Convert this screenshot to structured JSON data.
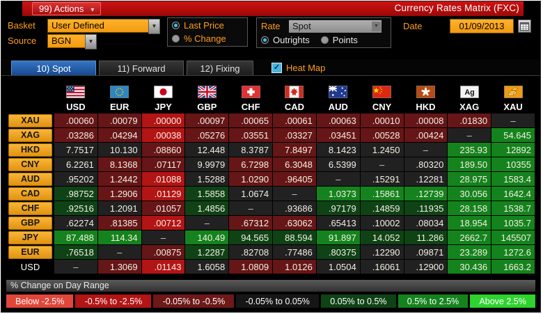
{
  "titlebar": {
    "actions_label": "99) Actions",
    "title": "Currency Rates Matrix (FXC)"
  },
  "icons": {
    "dropdown": "▼",
    "caret": "▾"
  },
  "controls": {
    "basket_label": "Basket",
    "basket_value": "User Defined",
    "source_label": "Source",
    "source_value": "BGN",
    "price_options": [
      {
        "label": "Last Price",
        "selected": true
      },
      {
        "label": "% Change",
        "selected": false
      }
    ],
    "rate_label": "Rate",
    "rate_value": "Spot",
    "rate_options": [
      {
        "label": "Outrights",
        "selected": true
      },
      {
        "label": "Points",
        "selected": false
      }
    ],
    "date_label": "Date",
    "date_value": "01/09/2013"
  },
  "tabs": [
    {
      "label": "10) Spot",
      "selected": true
    },
    {
      "label": "11) Forward",
      "selected": false
    },
    {
      "label": "12) Fixing",
      "selected": false
    }
  ],
  "heatmap": {
    "label": "Heat Map",
    "checked": true,
    "check_glyph": "✓"
  },
  "palette": {
    "r3": "#e2463a",
    "r2": "#b31414",
    "r1": "#661616",
    "n": "#212121",
    "g1": "#0f4316",
    "g2": "#15831d",
    "g3": "#2ed32e"
  },
  "matrix": {
    "columns": [
      "USD",
      "EUR",
      "JPY",
      "GBP",
      "CHF",
      "CAD",
      "AUD",
      "CNY",
      "HKD",
      "XAG",
      "XAU"
    ],
    "rows": [
      {
        "label": "XAU",
        "label_style": "button",
        "cells": [
          {
            "v": ".00060",
            "c": "r1"
          },
          {
            "v": ".00079",
            "c": "r1"
          },
          {
            "v": ".00000",
            "c": "r2"
          },
          {
            "v": ".00097",
            "c": "r1"
          },
          {
            "v": ".00065",
            "c": "r1"
          },
          {
            "v": ".00061",
            "c": "r1"
          },
          {
            "v": ".00063",
            "c": "r1"
          },
          {
            "v": ".00010",
            "c": "r1"
          },
          {
            "v": ".00008",
            "c": "r1"
          },
          {
            "v": ".01830",
            "c": "r1"
          },
          {
            "v": "–",
            "c": "n"
          }
        ]
      },
      {
        "label": "XAG",
        "label_style": "button",
        "cells": [
          {
            "v": ".03286",
            "c": "r1"
          },
          {
            "v": ".04294",
            "c": "r1"
          },
          {
            "v": ".00038",
            "c": "r2"
          },
          {
            "v": ".05276",
            "c": "r1"
          },
          {
            "v": ".03551",
            "c": "r1"
          },
          {
            "v": ".03327",
            "c": "r1"
          },
          {
            "v": ".03451",
            "c": "r1"
          },
          {
            "v": ".00528",
            "c": "r1"
          },
          {
            "v": ".00424",
            "c": "r1"
          },
          {
            "v": "–",
            "c": "n"
          },
          {
            "v": "54.645",
            "c": "g2"
          }
        ]
      },
      {
        "label": "HKD",
        "label_style": "button",
        "cells": [
          {
            "v": "7.7517",
            "c": "n"
          },
          {
            "v": "10.130",
            "c": "n"
          },
          {
            "v": ".08860",
            "c": "r1"
          },
          {
            "v": "12.448",
            "c": "n"
          },
          {
            "v": "8.3787",
            "c": "n"
          },
          {
            "v": "7.8497",
            "c": "r1"
          },
          {
            "v": "8.1423",
            "c": "n"
          },
          {
            "v": "1.2450",
            "c": "n"
          },
          {
            "v": "–",
            "c": "n"
          },
          {
            "v": "235.93",
            "c": "g2"
          },
          {
            "v": "12892",
            "c": "g2"
          }
        ]
      },
      {
        "label": "CNY",
        "label_style": "button",
        "cells": [
          {
            "v": "6.2261",
            "c": "n"
          },
          {
            "v": "8.1368",
            "c": "r1"
          },
          {
            "v": ".07117",
            "c": "r1"
          },
          {
            "v": "9.9979",
            "c": "n"
          },
          {
            "v": "6.7298",
            "c": "r1"
          },
          {
            "v": "6.3048",
            "c": "r1"
          },
          {
            "v": "6.5399",
            "c": "n"
          },
          {
            "v": "–",
            "c": "n"
          },
          {
            "v": ".80320",
            "c": "n"
          },
          {
            "v": "189.50",
            "c": "g2"
          },
          {
            "v": "10355",
            "c": "g2"
          }
        ]
      },
      {
        "label": "AUD",
        "label_style": "button",
        "cells": [
          {
            "v": ".95202",
            "c": "n"
          },
          {
            "v": "1.2442",
            "c": "r1"
          },
          {
            "v": ".01088",
            "c": "r2"
          },
          {
            "v": "1.5288",
            "c": "n"
          },
          {
            "v": "1.0290",
            "c": "r1"
          },
          {
            "v": ".96405",
            "c": "r1"
          },
          {
            "v": "–",
            "c": "n"
          },
          {
            "v": ".15291",
            "c": "n"
          },
          {
            "v": ".12281",
            "c": "n"
          },
          {
            "v": "28.975",
            "c": "g2"
          },
          {
            "v": "1583.4",
            "c": "g2"
          }
        ]
      },
      {
        "label": "CAD",
        "label_style": "button",
        "cells": [
          {
            "v": ".98752",
            "c": "g1"
          },
          {
            "v": "1.2906",
            "c": "r1"
          },
          {
            "v": ".01129",
            "c": "r2"
          },
          {
            "v": "1.5858",
            "c": "g1"
          },
          {
            "v": "1.0674",
            "c": "n"
          },
          {
            "v": "–",
            "c": "n"
          },
          {
            "v": "1.0373",
            "c": "g2"
          },
          {
            "v": ".15861",
            "c": "g2"
          },
          {
            "v": ".12739",
            "c": "g2"
          },
          {
            "v": "30.056",
            "c": "g2"
          },
          {
            "v": "1642.4",
            "c": "g2"
          }
        ]
      },
      {
        "label": "CHF",
        "label_style": "button",
        "cells": [
          {
            "v": ".92516",
            "c": "g1"
          },
          {
            "v": "1.2091",
            "c": "n"
          },
          {
            "v": ".01057",
            "c": "r1"
          },
          {
            "v": "1.4856",
            "c": "g1"
          },
          {
            "v": "–",
            "c": "n"
          },
          {
            "v": ".93686",
            "c": "n"
          },
          {
            "v": ".97179",
            "c": "g1"
          },
          {
            "v": ".14859",
            "c": "g1"
          },
          {
            "v": ".11935",
            "c": "g1"
          },
          {
            "v": "28.158",
            "c": "g2"
          },
          {
            "v": "1538.7",
            "c": "g2"
          }
        ]
      },
      {
        "label": "GBP",
        "label_style": "button",
        "cells": [
          {
            "v": ".62274",
            "c": "n"
          },
          {
            "v": ".81385",
            "c": "r1"
          },
          {
            "v": ".00712",
            "c": "r2"
          },
          {
            "v": "–",
            "c": "n"
          },
          {
            "v": ".67312",
            "c": "r1"
          },
          {
            "v": ".63062",
            "c": "r1"
          },
          {
            "v": ".65413",
            "c": "n"
          },
          {
            "v": ".10002",
            "c": "n"
          },
          {
            "v": ".08034",
            "c": "n"
          },
          {
            "v": "18.954",
            "c": "g2"
          },
          {
            "v": "1035.7",
            "c": "g2"
          }
        ]
      },
      {
        "label": "JPY",
        "label_style": "button",
        "cells": [
          {
            "v": "87.488",
            "c": "g2"
          },
          {
            "v": "114.34",
            "c": "g2"
          },
          {
            "v": "–",
            "c": "n"
          },
          {
            "v": "140.49",
            "c": "g2"
          },
          {
            "v": "94.565",
            "c": "g1"
          },
          {
            "v": "88.594",
            "c": "g1"
          },
          {
            "v": "91.897",
            "c": "g2"
          },
          {
            "v": "14.052",
            "c": "g1"
          },
          {
            "v": "11.286",
            "c": "g1"
          },
          {
            "v": "2662.7",
            "c": "g2"
          },
          {
            "v": "145507",
            "c": "g2"
          }
        ]
      },
      {
        "label": "EUR",
        "label_style": "button",
        "cells": [
          {
            "v": ".76518",
            "c": "g1"
          },
          {
            "v": "–",
            "c": "n"
          },
          {
            "v": ".00875",
            "c": "r1"
          },
          {
            "v": "1.2287",
            "c": "g1"
          },
          {
            "v": ".82708",
            "c": "n"
          },
          {
            "v": ".77486",
            "c": "n"
          },
          {
            "v": ".80375",
            "c": "g1"
          },
          {
            "v": ".12290",
            "c": "n"
          },
          {
            "v": ".09871",
            "c": "n"
          },
          {
            "v": "23.289",
            "c": "g2"
          },
          {
            "v": "1272.6",
            "c": "g2"
          }
        ]
      },
      {
        "label": "USD",
        "label_style": "plain",
        "cells": [
          {
            "v": "–",
            "c": "n"
          },
          {
            "v": "1.3069",
            "c": "r1"
          },
          {
            "v": ".01143",
            "c": "r2"
          },
          {
            "v": "1.6058",
            "c": "n"
          },
          {
            "v": "1.0809",
            "c": "r1"
          },
          {
            "v": "1.0126",
            "c": "r1"
          },
          {
            "v": "1.0504",
            "c": "n"
          },
          {
            "v": ".16061",
            "c": "n"
          },
          {
            "v": ".12900",
            "c": "n"
          },
          {
            "v": "30.436",
            "c": "g2"
          },
          {
            "v": "1663.2",
            "c": "g2"
          }
        ]
      }
    ]
  },
  "legend": {
    "title": "% Change on Day Range",
    "items": [
      {
        "label": "Below -2.5%",
        "color": "#e2463a"
      },
      {
        "label": "-0.5% to -2.5%",
        "color": "#b31414"
      },
      {
        "label": "-0.05% to -0.5%",
        "color": "#6e1818"
      },
      {
        "label": "-0.05% to 0.05%",
        "color": "#161616"
      },
      {
        "label": "0.05% to 0.5%",
        "color": "#0f4316"
      },
      {
        "label": "0.5% to 2.5%",
        "color": "#15831d"
      },
      {
        "label": "Above 2.5%",
        "color": "#2ed32e"
      }
    ]
  }
}
